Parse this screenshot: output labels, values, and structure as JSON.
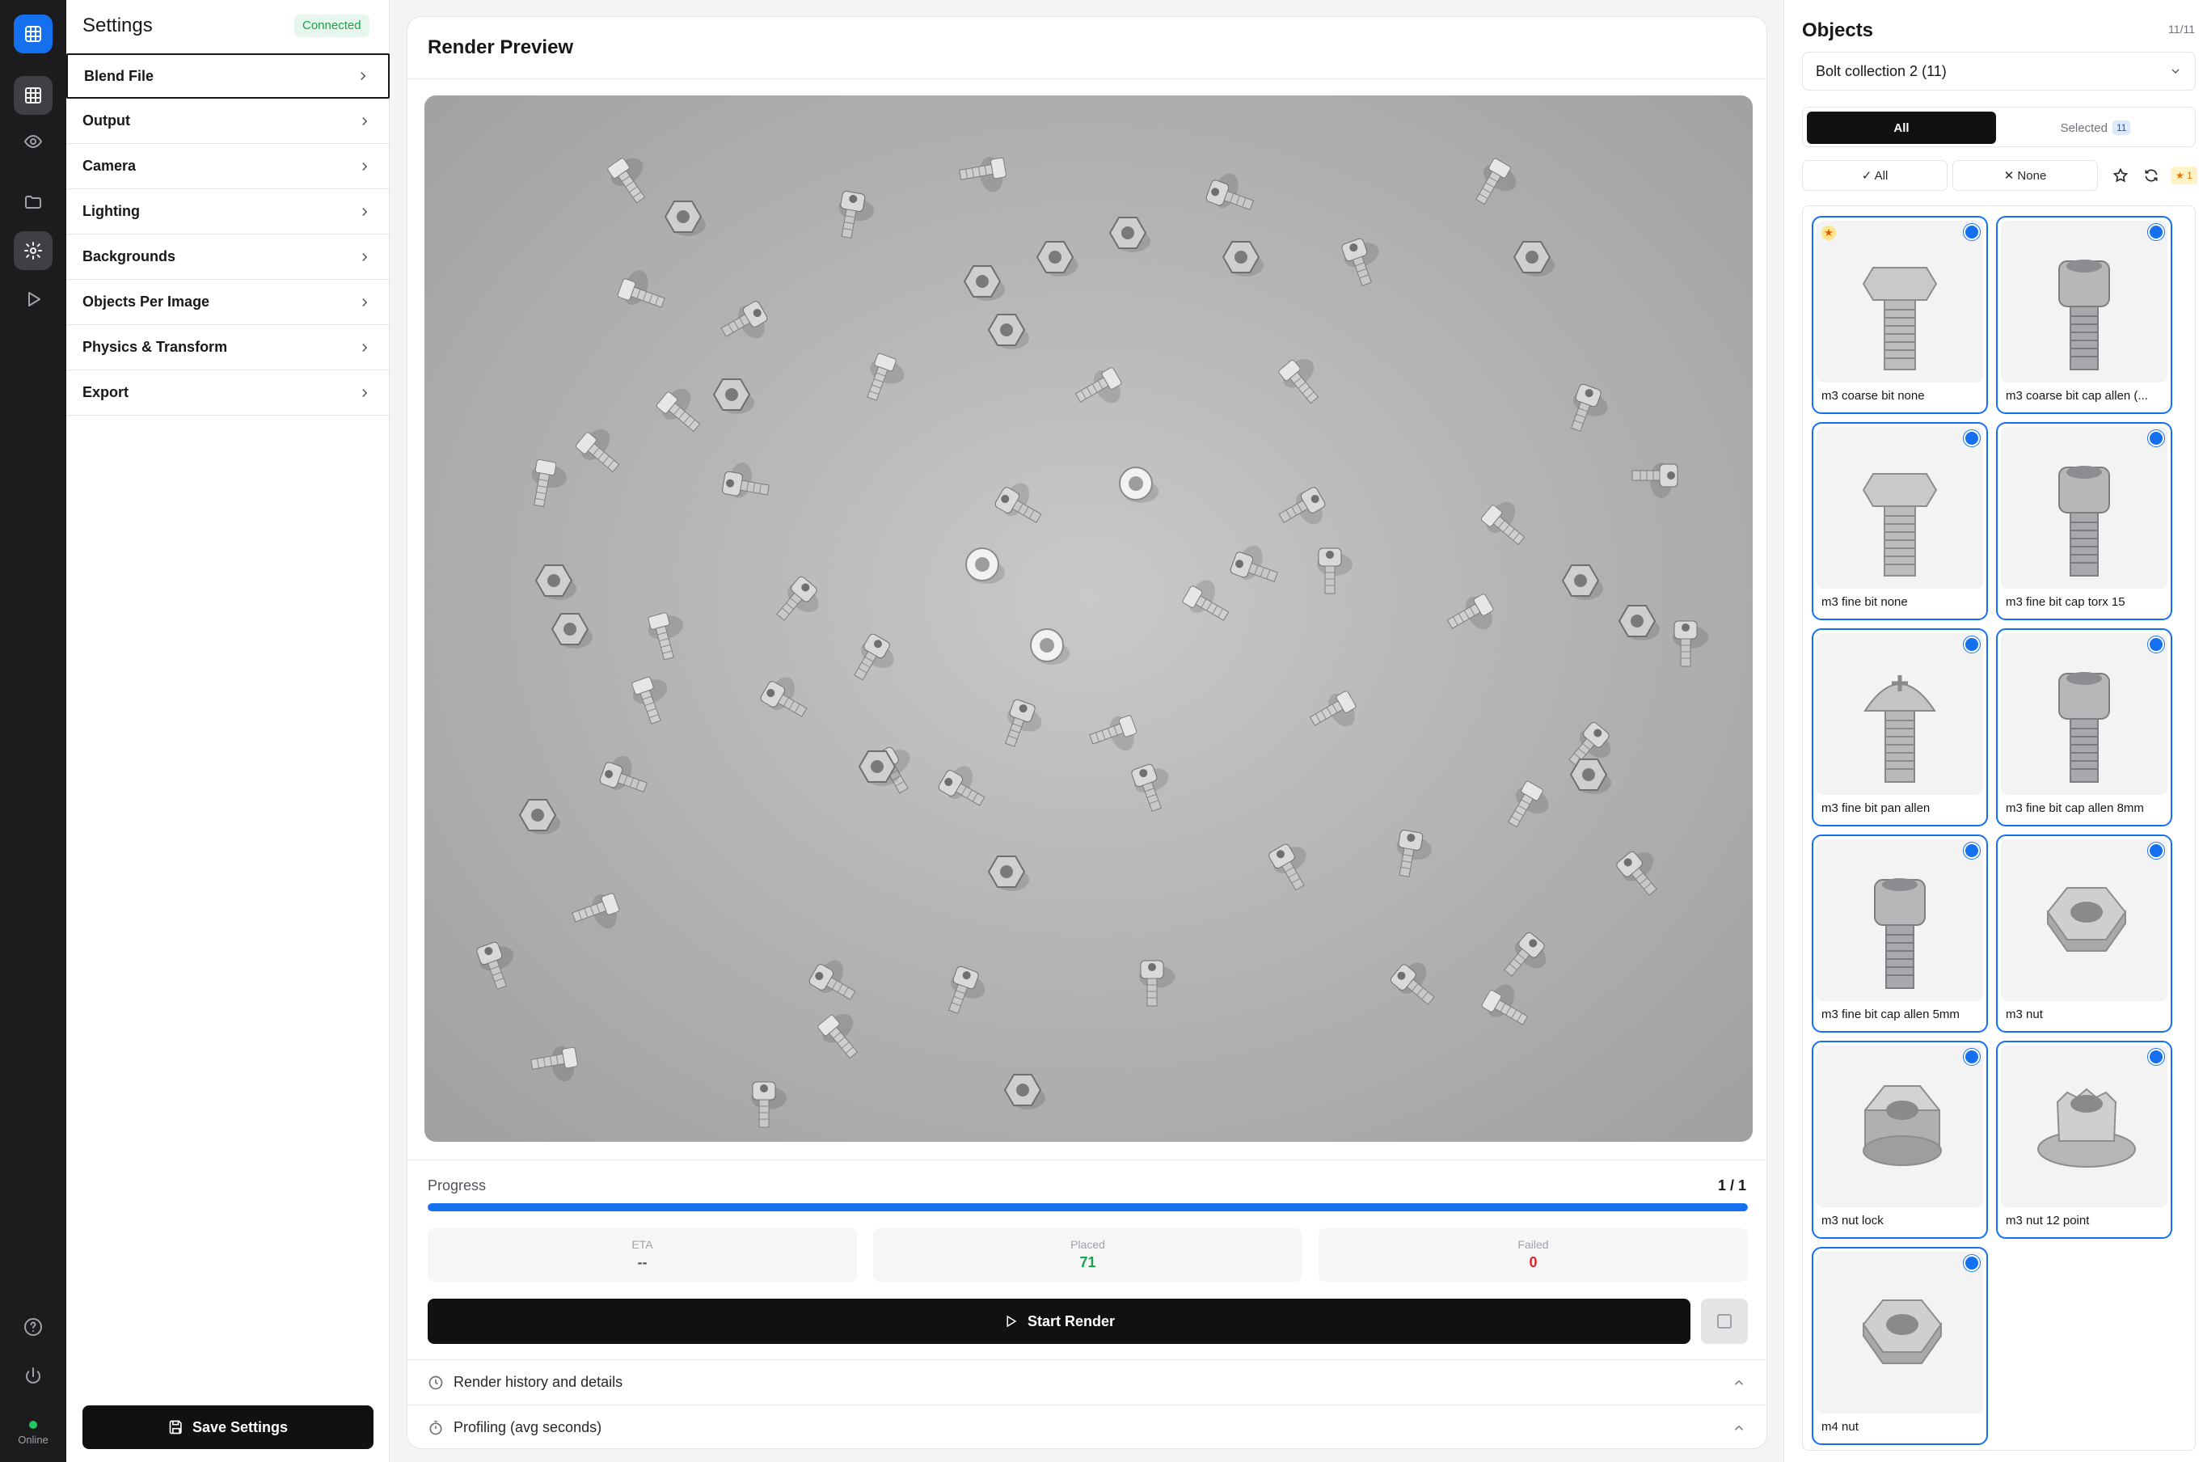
{
  "settings": {
    "title": "Settings",
    "status": "Connected",
    "menu": [
      "Blend File",
      "Output",
      "Camera",
      "Lighting",
      "Backgrounds",
      "Objects Per Image",
      "Physics & Transform",
      "Export"
    ],
    "active_item": "Blend File",
    "save_label": "Save Settings"
  },
  "rail": {
    "icons": [
      "app-logo-icon",
      "grid-icon",
      "eye-icon",
      "folder-icon",
      "gear-icon",
      "play-icon",
      "help-icon",
      "power-icon"
    ],
    "status_label": "Online"
  },
  "preview": {
    "title": "Render Preview",
    "image": "Rendered scene of scattered M3/M4 bolts, cap screws and nuts on a gray surface"
  },
  "progress": {
    "label": "Progress",
    "count": "1 / 1",
    "fraction": 1.0,
    "eta_label": "ETA",
    "eta_value": "--",
    "placed_label": "Placed",
    "placed_value": "71",
    "failed_label": "Failed",
    "failed_value": "0"
  },
  "actions": {
    "start_label": "Start Render",
    "history_label": "Render history and details",
    "profiling_label": "Profiling (avg seconds)"
  },
  "objects": {
    "title": "Objects",
    "count": "11/11",
    "collection": "Bolt collection 2 (11)",
    "tab_all": "All",
    "tab_selected": "Selected",
    "selected_count": "11",
    "select_all": "✓ All",
    "select_none": "✕ None",
    "fav_count": "★ 1",
    "items": [
      {
        "label": "m3 coarse bit none",
        "kind": "hex-bolt",
        "favorite": true
      },
      {
        "label": "m3 coarse bit cap allen (...",
        "kind": "cap-bolt",
        "favorite": false
      },
      {
        "label": "m3 fine bit none",
        "kind": "hex-bolt",
        "favorite": false
      },
      {
        "label": "m3 fine bit cap torx 15",
        "kind": "cap-bolt",
        "favorite": false
      },
      {
        "label": "m3 fine bit pan allen",
        "kind": "pan-bolt",
        "favorite": false
      },
      {
        "label": "m3 fine bit cap allen 8mm",
        "kind": "cap-bolt",
        "favorite": false
      },
      {
        "label": "m3 fine bit cap allen 5mm",
        "kind": "cap-bolt",
        "favorite": false
      },
      {
        "label": "m3 nut",
        "kind": "nut",
        "favorite": false
      },
      {
        "label": "m3 nut lock",
        "kind": "lock-nut",
        "favorite": false
      },
      {
        "label": "m3 nut 12 point",
        "kind": "flange-nut",
        "favorite": false
      },
      {
        "label": "m4 nut",
        "kind": "nut",
        "favorite": false
      }
    ]
  },
  "colors": {
    "accent": "#1570ef",
    "success": "#16a34a",
    "danger": "#dc2626",
    "dark": "#111111"
  }
}
